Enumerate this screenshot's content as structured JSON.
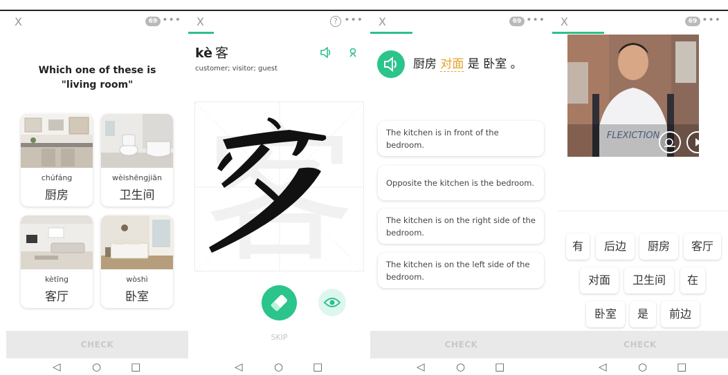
{
  "common": {
    "close_glyph": "X",
    "more_glyph": "•••",
    "check_label": "CHECK",
    "nav_back": "◁",
    "nav_home": "○",
    "nav_recent": "□",
    "accent_color": "#2dc08a"
  },
  "panel1": {
    "progress": 0,
    "question": "Which one of these is \"living room\"",
    "cards": [
      {
        "pinyin": "chúfáng",
        "hanzi": "厨房",
        "image": "kitchen-photo"
      },
      {
        "pinyin": "wèishēngjiān",
        "hanzi": "卫生间",
        "image": "bathroom-photo"
      },
      {
        "pinyin": "kètīng",
        "hanzi": "客厅",
        "image": "living-room-photo"
      },
      {
        "pinyin": "wòshì",
        "hanzi": "卧室",
        "image": "bedroom-photo"
      }
    ]
  },
  "panel2": {
    "progress": 0.14,
    "help_glyph": "?",
    "pinyin": "kè",
    "hanzi": "客",
    "meaning": "customer; visitor; guest",
    "skip_label": "SKIP"
  },
  "panel3": {
    "progress": 0.14,
    "sentence_before": "厨房 ",
    "sentence_highlight": "对面",
    "sentence_after": " 是 卧室 。",
    "options": [
      "The kitchen is in front of the bedroom.",
      "Opposite the kitchen is the bedroom.",
      "The kitchen is on the right side of the bedroom.",
      "The kitchen is on the left side of the bedroom."
    ]
  },
  "panel4": {
    "progress": 0.2,
    "video_shirt_text": "FLEXICTION",
    "word_tiles": [
      "有",
      "后边",
      "厨房",
      "客厅",
      "对面",
      "卫生间",
      "在",
      "卧室",
      "是",
      "前边"
    ]
  }
}
